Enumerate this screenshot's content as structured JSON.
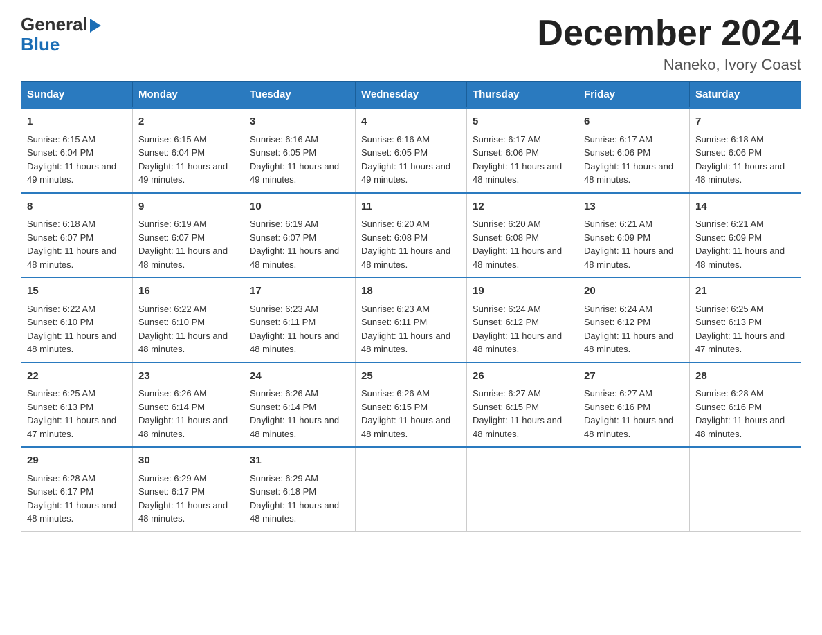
{
  "header": {
    "logo_general": "General",
    "logo_blue": "Blue",
    "month_title": "December 2024",
    "location": "Naneko, Ivory Coast"
  },
  "weekdays": [
    "Sunday",
    "Monday",
    "Tuesday",
    "Wednesday",
    "Thursday",
    "Friday",
    "Saturday"
  ],
  "weeks": [
    [
      {
        "day": "1",
        "sunrise": "6:15 AM",
        "sunset": "6:04 PM",
        "daylight": "11 hours and 49 minutes."
      },
      {
        "day": "2",
        "sunrise": "6:15 AM",
        "sunset": "6:04 PM",
        "daylight": "11 hours and 49 minutes."
      },
      {
        "day": "3",
        "sunrise": "6:16 AM",
        "sunset": "6:05 PM",
        "daylight": "11 hours and 49 minutes."
      },
      {
        "day": "4",
        "sunrise": "6:16 AM",
        "sunset": "6:05 PM",
        "daylight": "11 hours and 49 minutes."
      },
      {
        "day": "5",
        "sunrise": "6:17 AM",
        "sunset": "6:06 PM",
        "daylight": "11 hours and 48 minutes."
      },
      {
        "day": "6",
        "sunrise": "6:17 AM",
        "sunset": "6:06 PM",
        "daylight": "11 hours and 48 minutes."
      },
      {
        "day": "7",
        "sunrise": "6:18 AM",
        "sunset": "6:06 PM",
        "daylight": "11 hours and 48 minutes."
      }
    ],
    [
      {
        "day": "8",
        "sunrise": "6:18 AM",
        "sunset": "6:07 PM",
        "daylight": "11 hours and 48 minutes."
      },
      {
        "day": "9",
        "sunrise": "6:19 AM",
        "sunset": "6:07 PM",
        "daylight": "11 hours and 48 minutes."
      },
      {
        "day": "10",
        "sunrise": "6:19 AM",
        "sunset": "6:07 PM",
        "daylight": "11 hours and 48 minutes."
      },
      {
        "day": "11",
        "sunrise": "6:20 AM",
        "sunset": "6:08 PM",
        "daylight": "11 hours and 48 minutes."
      },
      {
        "day": "12",
        "sunrise": "6:20 AM",
        "sunset": "6:08 PM",
        "daylight": "11 hours and 48 minutes."
      },
      {
        "day": "13",
        "sunrise": "6:21 AM",
        "sunset": "6:09 PM",
        "daylight": "11 hours and 48 minutes."
      },
      {
        "day": "14",
        "sunrise": "6:21 AM",
        "sunset": "6:09 PM",
        "daylight": "11 hours and 48 minutes."
      }
    ],
    [
      {
        "day": "15",
        "sunrise": "6:22 AM",
        "sunset": "6:10 PM",
        "daylight": "11 hours and 48 minutes."
      },
      {
        "day": "16",
        "sunrise": "6:22 AM",
        "sunset": "6:10 PM",
        "daylight": "11 hours and 48 minutes."
      },
      {
        "day": "17",
        "sunrise": "6:23 AM",
        "sunset": "6:11 PM",
        "daylight": "11 hours and 48 minutes."
      },
      {
        "day": "18",
        "sunrise": "6:23 AM",
        "sunset": "6:11 PM",
        "daylight": "11 hours and 48 minutes."
      },
      {
        "day": "19",
        "sunrise": "6:24 AM",
        "sunset": "6:12 PM",
        "daylight": "11 hours and 48 minutes."
      },
      {
        "day": "20",
        "sunrise": "6:24 AM",
        "sunset": "6:12 PM",
        "daylight": "11 hours and 48 minutes."
      },
      {
        "day": "21",
        "sunrise": "6:25 AM",
        "sunset": "6:13 PM",
        "daylight": "11 hours and 47 minutes."
      }
    ],
    [
      {
        "day": "22",
        "sunrise": "6:25 AM",
        "sunset": "6:13 PM",
        "daylight": "11 hours and 47 minutes."
      },
      {
        "day": "23",
        "sunrise": "6:26 AM",
        "sunset": "6:14 PM",
        "daylight": "11 hours and 48 minutes."
      },
      {
        "day": "24",
        "sunrise": "6:26 AM",
        "sunset": "6:14 PM",
        "daylight": "11 hours and 48 minutes."
      },
      {
        "day": "25",
        "sunrise": "6:26 AM",
        "sunset": "6:15 PM",
        "daylight": "11 hours and 48 minutes."
      },
      {
        "day": "26",
        "sunrise": "6:27 AM",
        "sunset": "6:15 PM",
        "daylight": "11 hours and 48 minutes."
      },
      {
        "day": "27",
        "sunrise": "6:27 AM",
        "sunset": "6:16 PM",
        "daylight": "11 hours and 48 minutes."
      },
      {
        "day": "28",
        "sunrise": "6:28 AM",
        "sunset": "6:16 PM",
        "daylight": "11 hours and 48 minutes."
      }
    ],
    [
      {
        "day": "29",
        "sunrise": "6:28 AM",
        "sunset": "6:17 PM",
        "daylight": "11 hours and 48 minutes."
      },
      {
        "day": "30",
        "sunrise": "6:29 AM",
        "sunset": "6:17 PM",
        "daylight": "11 hours and 48 minutes."
      },
      {
        "day": "31",
        "sunrise": "6:29 AM",
        "sunset": "6:18 PM",
        "daylight": "11 hours and 48 minutes."
      },
      null,
      null,
      null,
      null
    ]
  ]
}
